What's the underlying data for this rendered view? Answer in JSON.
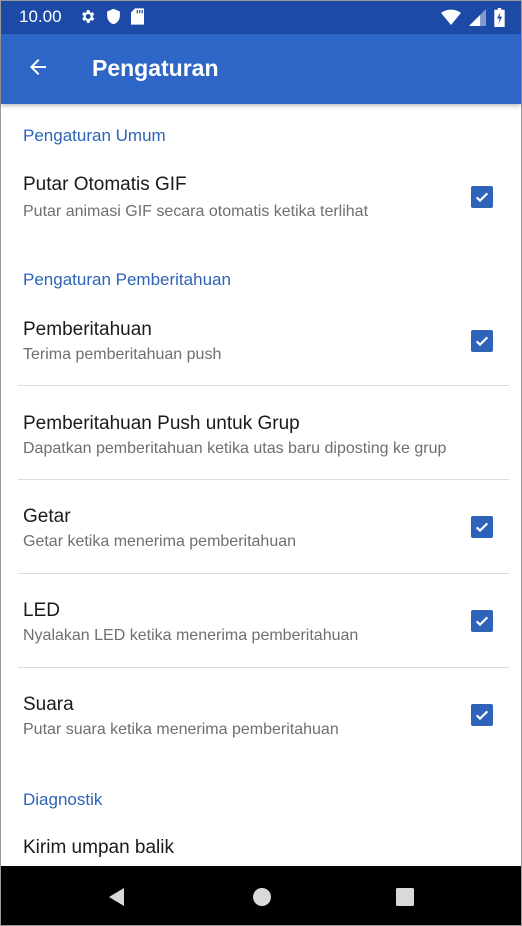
{
  "status": {
    "time": "10.00",
    "icons_left": [
      "gear-icon",
      "shield-icon",
      "sd-card-icon"
    ],
    "icons_right": [
      "wifi-icon",
      "signal-icon",
      "battery-icon"
    ]
  },
  "appbar": {
    "title": "Pengaturan",
    "back_icon": "arrow-left-icon"
  },
  "sections": {
    "general": {
      "header": "Pengaturan Umum",
      "autoplay_gif": {
        "title": "Putar Otomatis GIF",
        "subtitle": "Putar animasi GIF secara otomatis ketika terlihat",
        "checked": true
      }
    },
    "notifications": {
      "header": "Pengaturan Pemberitahuan",
      "notification": {
        "title": "Pemberitahuan",
        "subtitle": "Terima pemberitahuan push",
        "checked": true
      },
      "group_push": {
        "title": "Pemberitahuan Push untuk Grup",
        "subtitle": "Dapatkan pemberitahuan ketika utas baru diposting ke grup"
      },
      "vibrate": {
        "title": "Getar",
        "subtitle": "Getar ketika menerima pemberitahuan",
        "checked": true
      },
      "led": {
        "title": "LED",
        "subtitle": "Nyalakan LED ketika menerima pemberitahuan",
        "checked": true
      },
      "sound": {
        "title": "Suara",
        "subtitle": "Putar suara ketika menerima pemberitahuan",
        "checked": true
      }
    },
    "diagnostics": {
      "header": "Diagnostik",
      "feedback": {
        "title": "Kirim umpan balik"
      }
    }
  },
  "navbar": {
    "buttons": [
      "back-triangle-icon",
      "home-circle-icon",
      "recents-square-icon"
    ]
  },
  "colors": {
    "status_bar": "#1c4aa6",
    "app_bar": "#2d66c6",
    "accent": "#2d63b8"
  }
}
